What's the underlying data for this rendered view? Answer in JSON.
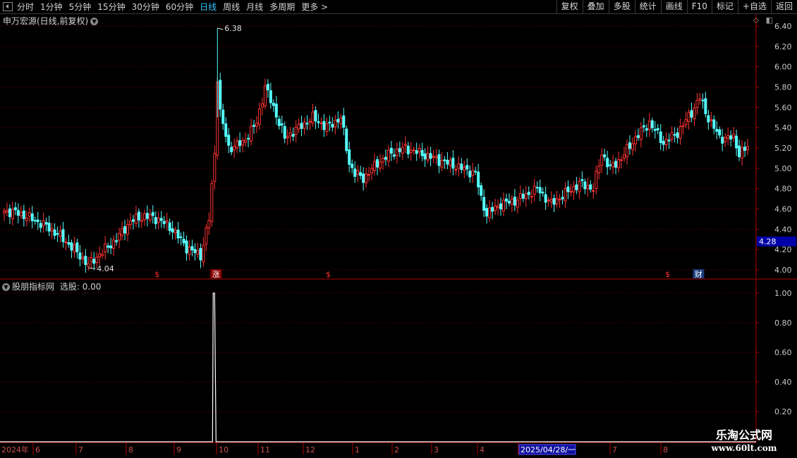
{
  "toolbar": {
    "periods": [
      "分时",
      "1分钟",
      "5分钟",
      "15分钟",
      "30分钟",
      "60分钟",
      "日线",
      "周线",
      "月线",
      "多周期",
      "更多 >"
    ],
    "active_period": "日线",
    "buttons": [
      "复权",
      "叠加",
      "多股",
      "统计",
      "画线",
      "F10",
      "标记",
      "+自选",
      "返回"
    ]
  },
  "main_title": "申万宏源(日线,前复权)",
  "indicator_title": "股朋指标网",
  "indicator_value": "选股: 0.00",
  "watermark": {
    "line1": "乐淘公式网",
    "line2": "www.60lt.com"
  },
  "colors": {
    "up": "#ff3232",
    "down": "#54ffff",
    "axis": "#b00000",
    "grid": "#7a0000",
    "price_box": "#0000a8",
    "signal": "#ffffff"
  },
  "chart_data": [
    {
      "type": "candlestick",
      "title": "申万宏源(日线,前复权)",
      "ylim": [
        3.92,
        6.5
      ],
      "y_ticks": [
        "6.40",
        "6.20",
        "6.00",
        "5.80",
        "5.60",
        "5.40",
        "5.20",
        "5.00",
        "4.80",
        "4.60",
        "4.40",
        "4.20",
        "4.00"
      ],
      "current_price": "4.28",
      "annotations": [
        {
          "label": "6.38",
          "value": 6.38
        },
        {
          "label": "4.04",
          "value": 4.04
        }
      ],
      "markers": [
        "$",
        "涨",
        "$",
        "$",
        "财"
      ],
      "keypoints": [
        [
          0,
          4.58
        ],
        [
          5,
          4.56
        ],
        [
          10,
          4.5
        ],
        [
          15,
          4.43
        ],
        [
          20,
          4.33
        ],
        [
          25,
          4.2
        ],
        [
          30,
          4.05
        ],
        [
          35,
          4.18
        ],
        [
          40,
          4.3
        ],
        [
          45,
          4.48
        ],
        [
          50,
          4.53
        ],
        [
          55,
          4.5
        ],
        [
          60,
          4.4
        ],
        [
          65,
          4.22
        ],
        [
          70,
          4.14
        ],
        [
          73,
          4.5
        ],
        [
          75,
          5.15
        ],
        [
          76,
          5.9
        ],
        [
          77,
          5.55
        ],
        [
          80,
          5.2
        ],
        [
          85,
          5.25
        ],
        [
          90,
          5.45
        ],
        [
          93,
          5.8
        ],
        [
          96,
          5.6
        ],
        [
          100,
          5.3
        ],
        [
          105,
          5.4
        ],
        [
          110,
          5.5
        ],
        [
          115,
          5.4
        ],
        [
          120,
          5.5
        ],
        [
          123,
          5.05
        ],
        [
          125,
          4.95
        ],
        [
          128,
          4.9
        ],
        [
          133,
          5.05
        ],
        [
          138,
          5.15
        ],
        [
          143,
          5.2
        ],
        [
          148,
          5.15
        ],
        [
          153,
          5.1
        ],
        [
          158,
          5.05
        ],
        [
          163,
          5.0
        ],
        [
          168,
          4.95
        ],
        [
          170,
          4.7
        ],
        [
          172,
          4.55
        ],
        [
          177,
          4.65
        ],
        [
          182,
          4.68
        ],
        [
          187,
          4.75
        ],
        [
          190,
          4.8
        ],
        [
          195,
          4.65
        ],
        [
          200,
          4.75
        ],
        [
          205,
          4.85
        ],
        [
          210,
          4.8
        ],
        [
          213,
          5.15
        ],
        [
          216,
          5.0
        ],
        [
          220,
          5.1
        ],
        [
          225,
          5.3
        ],
        [
          230,
          5.45
        ],
        [
          235,
          5.25
        ],
        [
          240,
          5.35
        ],
        [
          245,
          5.55
        ],
        [
          248,
          5.7
        ],
        [
          250,
          5.55
        ],
        [
          255,
          5.3
        ],
        [
          260,
          5.3
        ],
        [
          262,
          5.15
        ],
        [
          265,
          5.2
        ]
      ]
    },
    {
      "type": "line",
      "series": [
        {
          "name": "选股",
          "values_note": "single spike"
        }
      ],
      "ylim": [
        0.1,
        1.05
      ],
      "y_ticks": [
        "1.00",
        "0.80",
        "0.60",
        "0.40",
        "0.20"
      ],
      "spike": {
        "index": 75,
        "value": 1.0
      }
    }
  ],
  "x_axis": {
    "labels": [
      "2024年",
      "6",
      "7",
      "8",
      "9",
      "10",
      "11",
      "12",
      "1",
      "2",
      "3",
      "4",
      "2025/04/28/一",
      "7",
      "8"
    ],
    "highlight_label": "2025/04/28/一"
  }
}
